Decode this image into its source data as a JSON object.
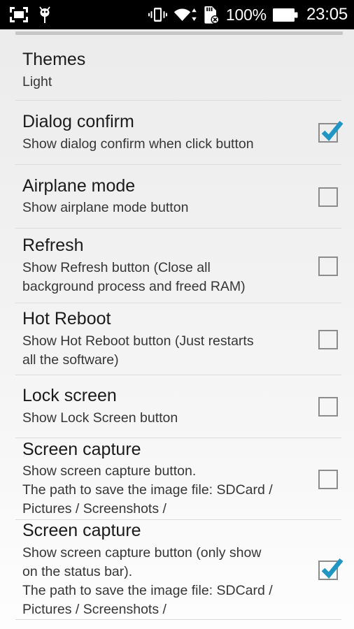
{
  "statusbar": {
    "icons_left": [
      {
        "name": "screen-capture-icon",
        "label": "screen capture"
      },
      {
        "name": "android-bug-icon",
        "label": "android agent"
      }
    ],
    "icons_right": [
      {
        "name": "vibrate-icon",
        "label": "vibrate"
      },
      {
        "name": "wifi-icon",
        "label": "wifi with data transfer arrows"
      },
      {
        "name": "sdcard-removed-icon",
        "label": "sd card removed"
      }
    ],
    "battery_percent": "100%",
    "battery_icon": "battery-full-icon",
    "clock": "23:05"
  },
  "list": {
    "edge_indicator": "list-top-edge",
    "rows": [
      {
        "key": "themes",
        "title": "Themes",
        "summary": [
          "Light"
        ],
        "widget": "none",
        "checked": false
      },
      {
        "key": "dialog-confirm",
        "title": "Dialog confirm",
        "summary": [
          "Show dialog confirm when click button"
        ],
        "widget": "checkbox",
        "checked": true
      },
      {
        "key": "airplane-mode",
        "title": "Airplane mode",
        "summary": [
          "Show airplane mode button"
        ],
        "widget": "checkbox",
        "checked": false
      },
      {
        "key": "refresh",
        "title": "Refresh",
        "summary": [
          "Show Refresh button (Close all",
          "background process and freed RAM)"
        ],
        "widget": "checkbox",
        "checked": false
      },
      {
        "key": "hot-reboot",
        "title": "Hot Reboot",
        "summary": [
          "Show Hot Reboot button (Just restarts",
          "all the software)"
        ],
        "widget": "checkbox",
        "checked": false
      },
      {
        "key": "lock-screen",
        "title": "Lock screen",
        "summary": [
          "Show Lock Screen button"
        ],
        "widget": "checkbox",
        "checked": false
      },
      {
        "key": "screen-capture",
        "title": "Screen capture",
        "summary": [
          "Show screen capture button.",
          "The path to save the image file: SDCard /",
          "Pictures / Screenshots /"
        ],
        "widget": "checkbox",
        "checked": false
      },
      {
        "key": "screen-capture-status-bar",
        "title": "Screen capture",
        "summary": [
          "Show screen capture button (only show",
          "on the status bar).",
          "The path to save the image file: SDCard /",
          "Pictures / Screenshots /"
        ],
        "widget": "checkbox",
        "checked": true
      }
    ]
  },
  "colors": {
    "statusbar_bg": "#000000",
    "statusbar_fg": "#ffffff",
    "list_bg_top": "#ececec",
    "list_bg_bottom": "#fdfdfd",
    "title_text": "#1b1b1b",
    "summary_text": "#363636",
    "divider": "#dcdcdc",
    "checkbox_border": "#8c8c8c",
    "checkbox_tick": "#2196c4"
  }
}
